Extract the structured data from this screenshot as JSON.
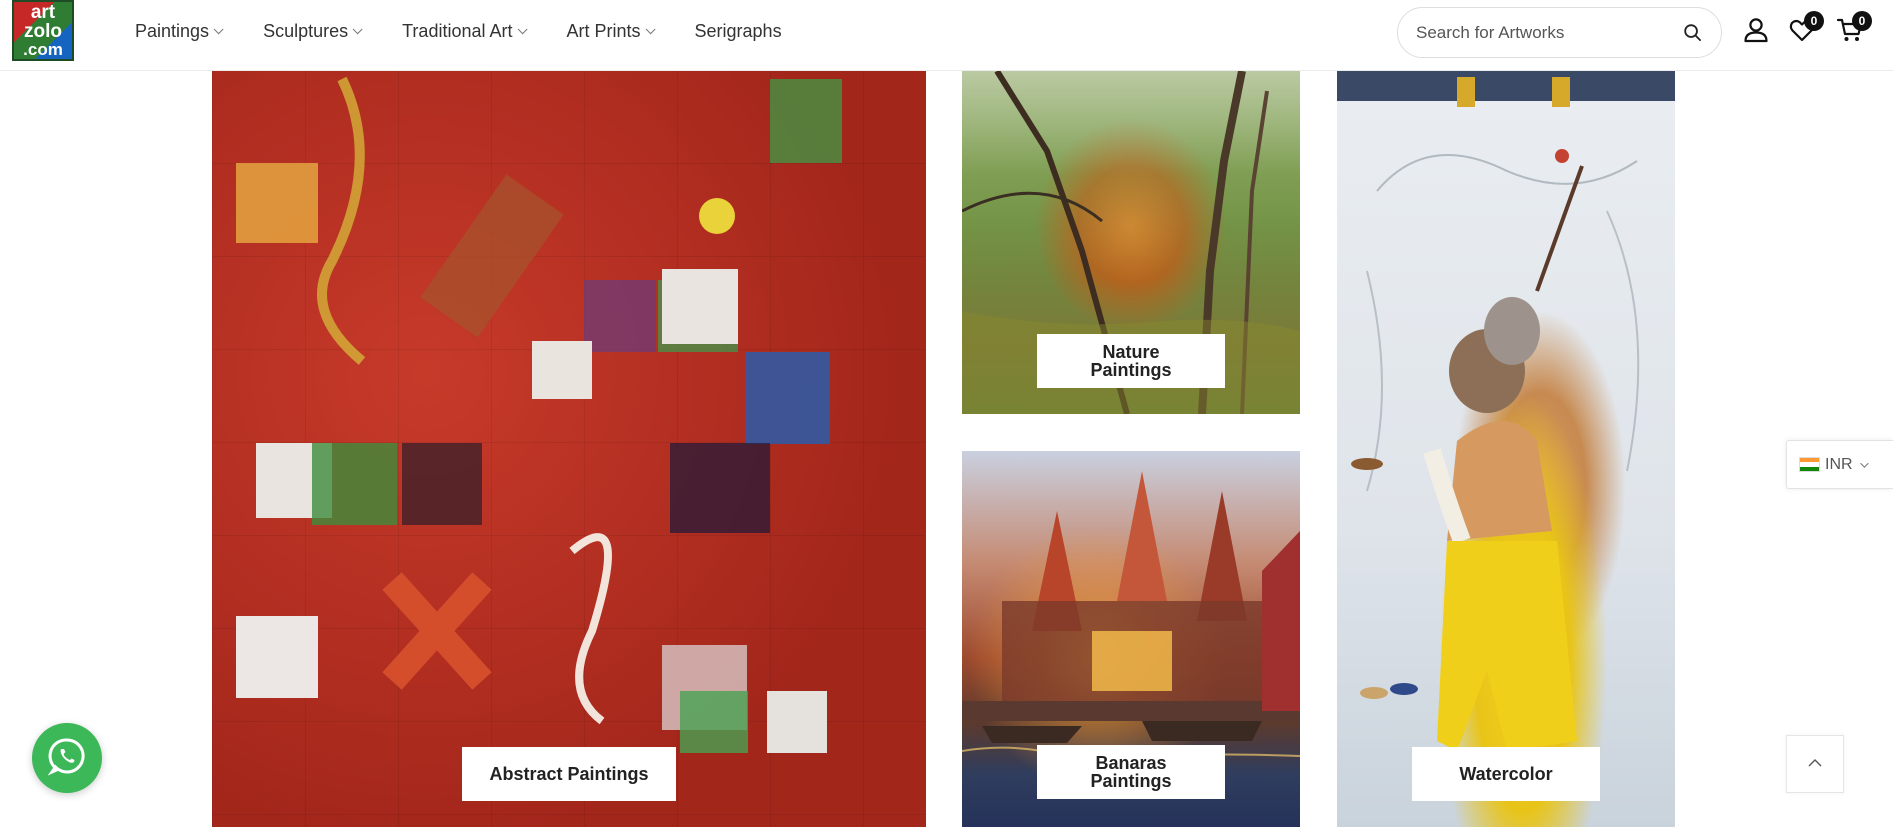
{
  "brand": {
    "logo_lines": [
      "art",
      "zolo",
      ".com"
    ],
    "colors": {
      "red": "#c62828",
      "green": "#2e7d32",
      "blue": "#1565c0"
    }
  },
  "nav": {
    "items": [
      {
        "label": "Paintings",
        "has_dropdown": true
      },
      {
        "label": "Sculptures",
        "has_dropdown": true
      },
      {
        "label": "Traditional Art",
        "has_dropdown": true
      },
      {
        "label": "Art Prints",
        "has_dropdown": true
      },
      {
        "label": "Serigraphs",
        "has_dropdown": false
      }
    ]
  },
  "search": {
    "placeholder": "Search for Artworks",
    "icon": "search-icon"
  },
  "header_icons": {
    "account": {
      "icon": "user-icon"
    },
    "wishlist": {
      "icon": "heart-icon",
      "count": "0"
    },
    "cart": {
      "icon": "cart-icon",
      "count": "0"
    }
  },
  "tiles": [
    {
      "label": "Abstract Paintings"
    },
    {
      "label_line1": "Nature",
      "label_line2": "Paintings"
    },
    {
      "label_line1": "Banaras",
      "label_line2": "Paintings"
    },
    {
      "label": "Watercolor"
    }
  ],
  "currency": {
    "code": "INR",
    "flag_colors": [
      "#ff9933",
      "#ffffff",
      "#138808"
    ]
  },
  "floating": {
    "whatsapp_icon": "whatsapp-icon",
    "whatsapp_color": "#3cb859",
    "back_to_top_icon": "chevron-up-icon"
  }
}
